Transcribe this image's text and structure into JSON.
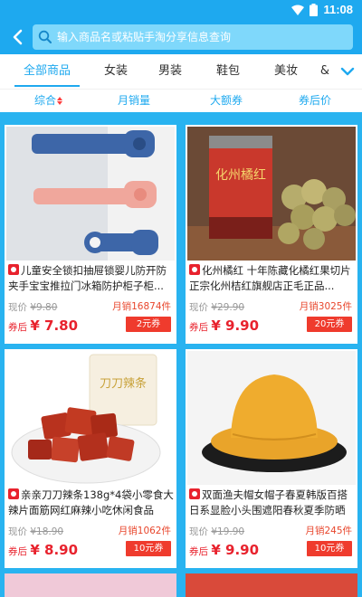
{
  "status_bar": {
    "time": "11:08"
  },
  "search": {
    "placeholder": "输入商品名或粘贴手淘分享信息查询"
  },
  "categories": [
    "全部商品",
    "女装",
    "男装",
    "鞋包",
    "美妆",
    "&"
  ],
  "sort": [
    "综合",
    "月销量",
    "大额券",
    "券后价"
  ],
  "labels": {
    "orig_prefix": "现价",
    "after_prefix_current": "券后",
    "after_prefix_coupon": "券后",
    "sales_prefix": "月销"
  },
  "products": [
    {
      "title": "儿童安全锁扣抽屉锁婴儿防开防夹手宝宝推拉门冰箱防护柜子柜...",
      "orig_label": "现价",
      "orig_price": "¥9.80",
      "after_label": "券后",
      "after_price": "¥ 7.80",
      "sales": "月销16874件",
      "coupon": "2元券"
    },
    {
      "title": "化州橘红 十年陈藏化橘红果切片正宗化州桔红旗舰店正毛正品...",
      "orig_label": "现价",
      "orig_price": "¥29.90",
      "after_label": "券后",
      "after_price": "¥ 9.90",
      "sales": "月销3025件",
      "coupon": "20元券"
    },
    {
      "title": "亲亲刀刀辣条138g*4袋小零食大辣片面筋网红麻辣小吃休闲食品",
      "orig_label": "现价",
      "orig_price": "¥18.90",
      "after_label": "券后",
      "after_price": "¥ 8.90",
      "sales": "月销1062件",
      "coupon": "10元券"
    },
    {
      "title": "双面渔夫帽女帽子春夏韩版百搭日系显脸小头围遮阳春秋夏季防晒",
      "orig_label": "现价",
      "orig_price": "¥19.90",
      "after_label": "券后",
      "after_price": "¥ 9.90",
      "sales": "月销245件",
      "coupon": "10元券"
    }
  ],
  "image_labels": {
    "orange_tin": "化州橘红",
    "snack_bag": "刀刀辣条"
  },
  "colors": {
    "accent": "#1ea9ef",
    "background": "#29b3f0",
    "price_red": "#e8222d",
    "coupon_red": "#ef3b2d"
  },
  "icons": {
    "back": "chevron-left-icon",
    "search": "search-icon",
    "wifi": "wifi-icon",
    "battery": "battery-icon",
    "more": "chevron-down-icon"
  }
}
